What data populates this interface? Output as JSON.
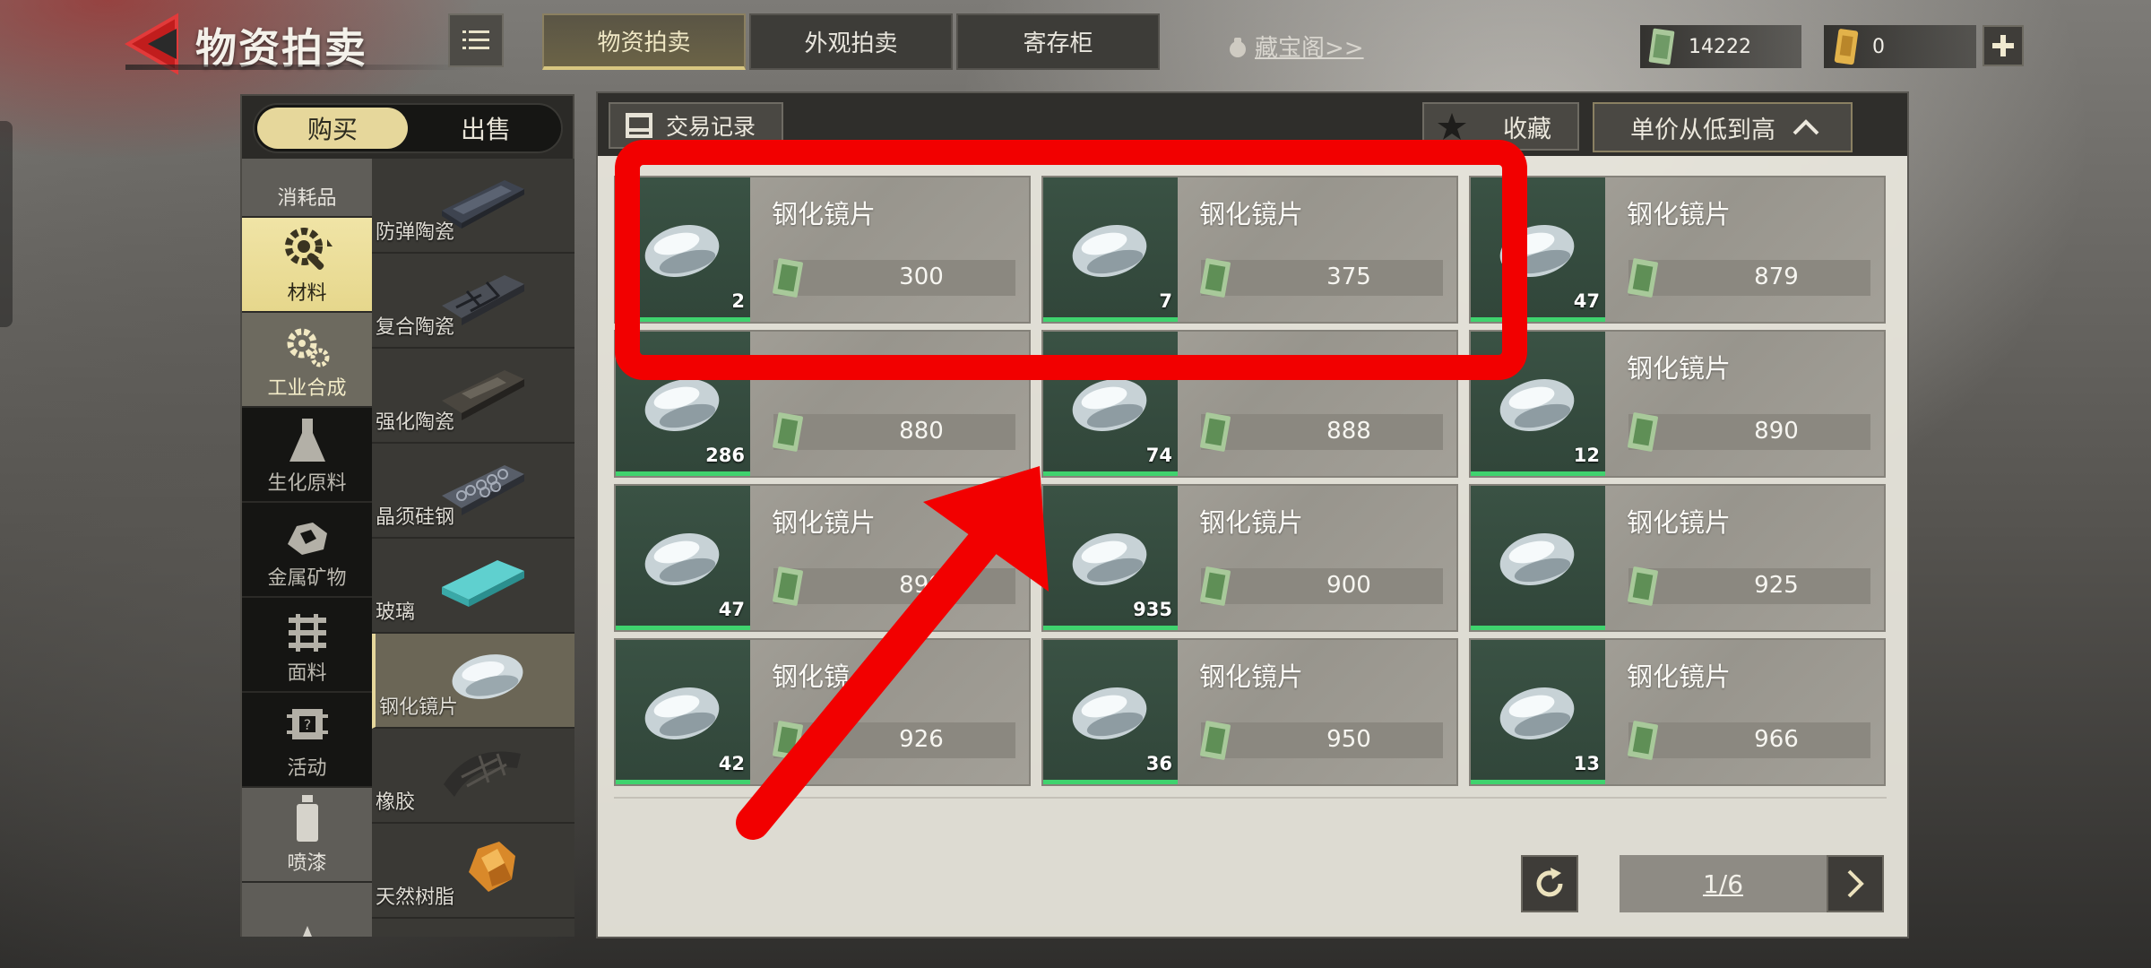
{
  "header": {
    "title": "物资拍卖",
    "tabs": [
      {
        "label": "物资拍卖",
        "active": true
      },
      {
        "label": "外观拍卖",
        "active": false
      },
      {
        "label": "寄存柜",
        "active": false
      }
    ],
    "treasure_link": "藏宝阁>>",
    "currency_cash": "14222",
    "currency_ticket": "0"
  },
  "left": {
    "buy_label": "购买",
    "sell_label": "出售",
    "categories": [
      {
        "label": "消耗品",
        "icon": "consumable-icon"
      },
      {
        "label": "材料",
        "icon": "materials-icon"
      },
      {
        "label": "工业合成",
        "icon": "gears-icon"
      },
      {
        "label": "生化原料",
        "icon": "flask-icon"
      },
      {
        "label": "金属矿物",
        "icon": "ore-icon"
      },
      {
        "label": "面料",
        "icon": "fabric-icon"
      },
      {
        "label": "活动",
        "icon": "chip-icon"
      },
      {
        "label": "喷漆",
        "icon": "spray-icon"
      },
      {
        "label": "",
        "icon": "boat-icon"
      }
    ],
    "subcategories": [
      {
        "label": "防弹陶瓷"
      },
      {
        "label": "复合陶瓷"
      },
      {
        "label": "强化陶瓷"
      },
      {
        "label": "晶须硅钢"
      },
      {
        "label": "玻璃"
      },
      {
        "label": "钢化镜片"
      },
      {
        "label": "橡胶"
      },
      {
        "label": "天然树脂"
      }
    ]
  },
  "main": {
    "trade_record_label": "交易记录",
    "favorite_label": "收藏",
    "sort_label": "单价从低到高",
    "items": [
      {
        "name": "钢化镜片",
        "qty": "2",
        "price": "300"
      },
      {
        "name": "钢化镜片",
        "qty": "7",
        "price": "375"
      },
      {
        "name": "钢化镜片",
        "qty": "47",
        "price": "879"
      },
      {
        "name": "",
        "qty": "286",
        "price": "880"
      },
      {
        "name": "",
        "qty": "74",
        "price": "888"
      },
      {
        "name": "钢化镜片",
        "qty": "12",
        "price": "890"
      },
      {
        "name": "钢化镜片",
        "qty": "47",
        "price": "899"
      },
      {
        "name": "钢化镜片",
        "qty": "935",
        "price": "900"
      },
      {
        "name": "钢化镜片",
        "qty": "",
        "price": "925"
      },
      {
        "name": "钢化镜",
        "qty": "42",
        "price": "926"
      },
      {
        "name": "钢化镜片",
        "qty": "36",
        "price": "950"
      },
      {
        "name": "钢化镜片",
        "qty": "13",
        "price": "966"
      }
    ],
    "page": "1/6"
  },
  "colors": {
    "accent_gold": "#e6d79b",
    "qty_bar_green": "#3fd36e",
    "annotation_red": "#f20000"
  }
}
